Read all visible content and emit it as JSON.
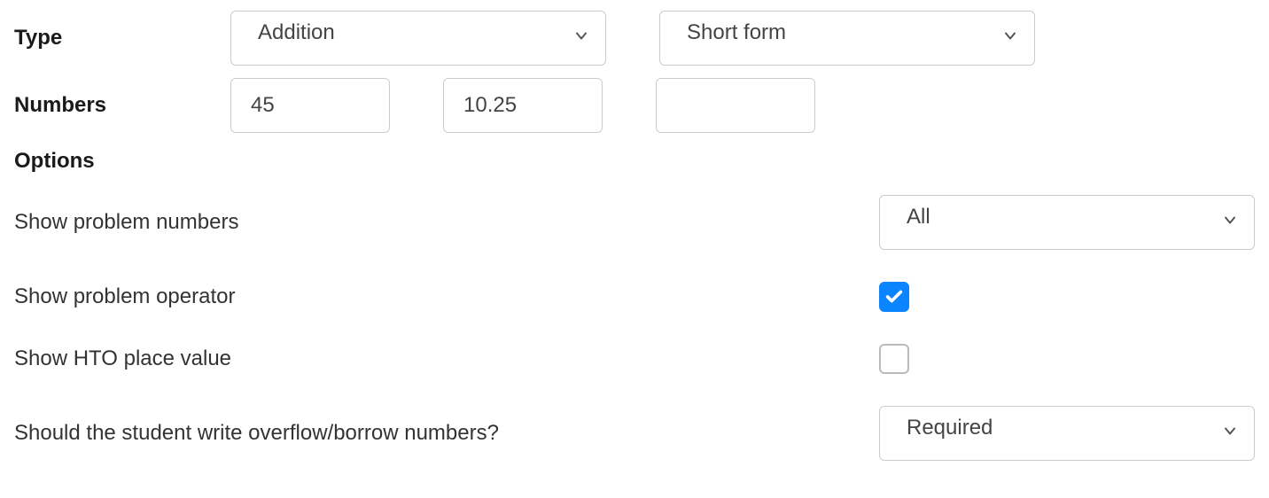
{
  "type": {
    "label": "Type",
    "operation_value": "Addition",
    "form_value": "Short form"
  },
  "numbers": {
    "label": "Numbers",
    "val1": "45",
    "val2": "10.25",
    "val3": ""
  },
  "options": {
    "title": "Options",
    "show_problem_numbers": {
      "label": "Show problem numbers",
      "value": "All"
    },
    "show_problem_operator": {
      "label": "Show problem operator",
      "checked": true
    },
    "show_hto": {
      "label": "Show HTO place value",
      "checked": false
    },
    "overflow": {
      "label": "Should the student write overflow/borrow numbers?",
      "value": "Required"
    }
  }
}
